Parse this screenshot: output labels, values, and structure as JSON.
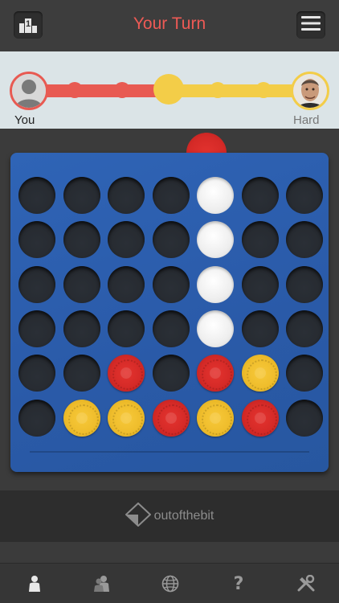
{
  "header": {
    "title": "Your Turn",
    "left_icon": "leaderboard-icon",
    "right_icon": "menu-icon",
    "leaderboard_label": "1",
    "title_color": "#ee5a55"
  },
  "progress": {
    "player_name": "You",
    "opponent_name": "Hard",
    "player_color": "#e85a52",
    "opponent_color": "#f3cd48"
  },
  "board": {
    "rows": 6,
    "columns": 7,
    "cells": [
      [
        "empty",
        "empty",
        "empty",
        "empty",
        "hint",
        "empty",
        "empty"
      ],
      [
        "empty",
        "empty",
        "empty",
        "empty",
        "hint",
        "empty",
        "empty"
      ],
      [
        "empty",
        "empty",
        "empty",
        "empty",
        "hint",
        "empty",
        "empty"
      ],
      [
        "empty",
        "empty",
        "empty",
        "empty",
        "hint",
        "empty",
        "empty"
      ],
      [
        "empty",
        "empty",
        "red",
        "empty",
        "red",
        "yellow",
        "empty"
      ],
      [
        "empty",
        "yellow",
        "yellow",
        "red",
        "yellow",
        "red",
        "empty"
      ]
    ],
    "board_color": "#2c5eae",
    "red_color": "#d52a27",
    "yellow_color": "#efbd2c"
  },
  "footer": {
    "brand_text": "outofthebit"
  },
  "tabbar": {
    "items": [
      {
        "name": "single-player-tab",
        "icon": "person-icon"
      },
      {
        "name": "two-player-tab",
        "icon": "two-persons-icon"
      },
      {
        "name": "online-tab",
        "icon": "globe-icon"
      },
      {
        "name": "help-tab",
        "icon": "question-icon"
      },
      {
        "name": "settings-tab",
        "icon": "tools-icon"
      }
    ]
  }
}
